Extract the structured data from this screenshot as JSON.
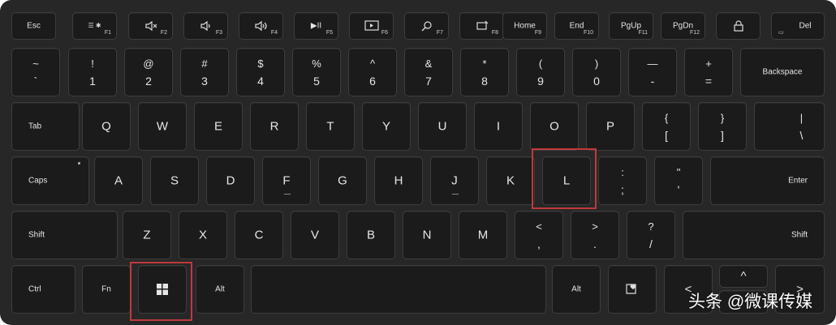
{
  "function_row": {
    "esc": "Esc",
    "f1": {
      "main": "☰ ✱",
      "sub": "F1"
    },
    "f2": {
      "sub": "F2"
    },
    "f3": {
      "sub": "F3"
    },
    "f4": {
      "sub": "F4"
    },
    "f5": {
      "main": "▶II",
      "sub": "F5"
    },
    "f6": {
      "sub": "F6"
    },
    "f7": {
      "sub": "F7"
    },
    "f8": {
      "sub": "F8"
    },
    "home": {
      "main": "Home",
      "sub": "F9"
    },
    "end": {
      "main": "End",
      "sub": "F10"
    },
    "pgup": {
      "main": "PgUp",
      "sub": "F11"
    },
    "pgdn": {
      "main": "PgDn",
      "sub": "F12"
    },
    "lock": {},
    "del": {
      "main": "Del",
      "sub": "▭"
    }
  },
  "number_row": {
    "keys": [
      {
        "top": "~",
        "bottom": "`"
      },
      {
        "top": "!",
        "bottom": "1"
      },
      {
        "top": "@",
        "bottom": "2"
      },
      {
        "top": "#",
        "bottom": "3"
      },
      {
        "top": "$",
        "bottom": "4"
      },
      {
        "top": "%",
        "bottom": "5"
      },
      {
        "top": "^",
        "bottom": "6"
      },
      {
        "top": "&",
        "bottom": "7"
      },
      {
        "top": "*",
        "bottom": "8"
      },
      {
        "top": "(",
        "bottom": "9"
      },
      {
        "top": ")",
        "bottom": "0"
      },
      {
        "top": "—",
        "bottom": "-"
      },
      {
        "top": "+",
        "bottom": "="
      }
    ],
    "backspace": "Backspace"
  },
  "qwerty_row": {
    "tab": "Tab",
    "letters": [
      "Q",
      "W",
      "E",
      "R",
      "T",
      "Y",
      "U",
      "I",
      "O",
      "P"
    ],
    "brackets": [
      {
        "top": "{",
        "bottom": "["
      },
      {
        "top": "}",
        "bottom": "]"
      },
      {
        "top": "|",
        "bottom": "\\"
      }
    ]
  },
  "home_row": {
    "caps": "Caps",
    "letters": [
      "A",
      "S",
      "D",
      "F",
      "G",
      "H",
      "J",
      "K",
      "L"
    ],
    "semicolon": {
      "top": ":",
      "bottom": ";"
    },
    "quote": {
      "top": "\"",
      "bottom": "'"
    },
    "enter": "Enter"
  },
  "bottom_letter_row": {
    "shift_left": "Shift",
    "letters": [
      "Z",
      "X",
      "C",
      "V",
      "B",
      "N",
      "M"
    ],
    "comma": {
      "top": "<",
      "bottom": ","
    },
    "period": {
      "top": ">",
      "bottom": "."
    },
    "slash": {
      "top": "?",
      "bottom": "/"
    },
    "shift_right": "Shift"
  },
  "modifier_row": {
    "ctrl": "Ctrl",
    "fn": "Fn",
    "win": "windows-logo-icon",
    "alt_left": "Alt",
    "alt_right": "Alt",
    "left_arrow": "<",
    "up_arrow": "^",
    "right_arrow": ">"
  },
  "highlights": [
    "L",
    "Windows"
  ],
  "highlight_color": "#c0393b",
  "watermark": "头条 @微课传媒"
}
